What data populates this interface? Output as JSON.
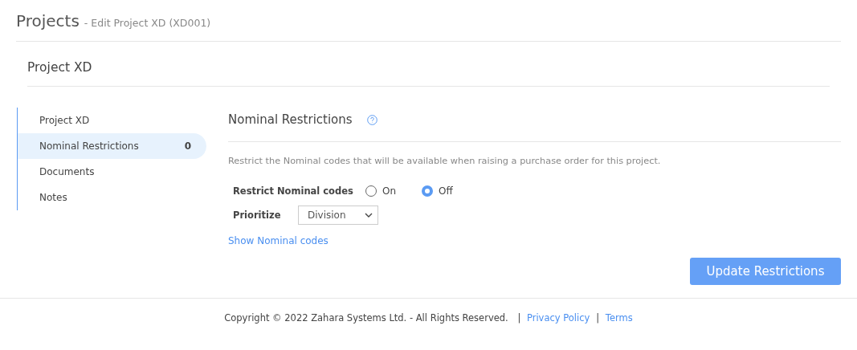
{
  "header": {
    "title": "Projects",
    "subtitle": "- Edit Project XD (XD001)"
  },
  "card": {
    "title": "Project XD"
  },
  "sidebar": {
    "items": [
      {
        "label": "Project XD",
        "selected": false
      },
      {
        "label": "Nominal Restrictions",
        "count": "0",
        "selected": true
      },
      {
        "label": "Documents",
        "selected": false
      },
      {
        "label": "Notes",
        "selected": false
      }
    ]
  },
  "section": {
    "title": "Nominal Restrictions",
    "description": "Restrict the Nominal codes that will be available when raising a purchase order for this project.",
    "restrict": {
      "label": "Restrict Nominal codes",
      "options": [
        {
          "label": "On",
          "selected": false
        },
        {
          "label": "Off",
          "selected": true
        }
      ]
    },
    "prioritize": {
      "label": "Prioritize",
      "value": "Division"
    },
    "link": "Show Nominal codes",
    "button": "Update Restrictions"
  },
  "footer": {
    "copyright": "Copyright © 2022 Zahara Systems Ltd. - All Rights Reserved.",
    "links": [
      {
        "separator": "|",
        "label": "Privacy Policy"
      },
      {
        "separator": "|",
        "label": "Terms"
      }
    ]
  }
}
